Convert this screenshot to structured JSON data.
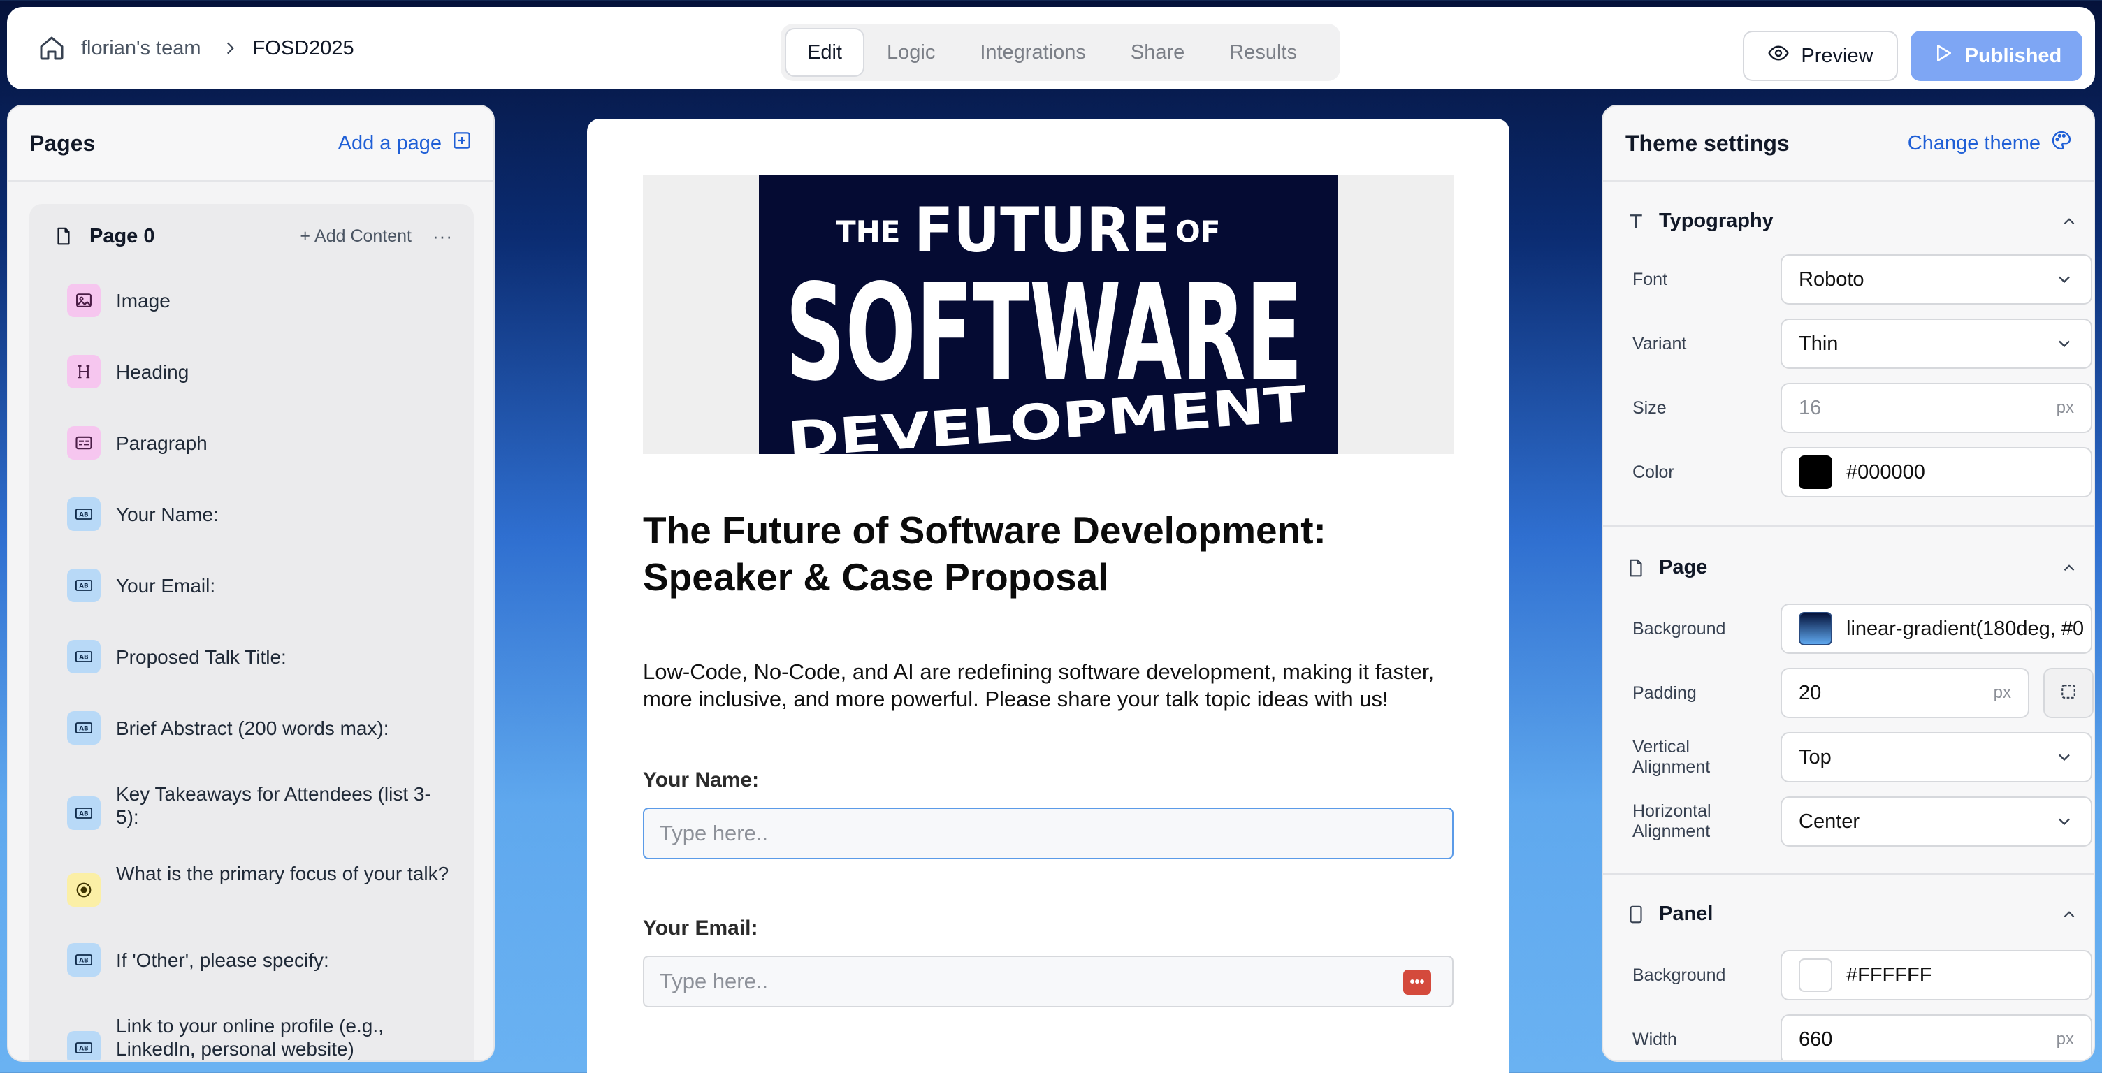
{
  "header": {
    "team": "florian's team",
    "project": "FOSD2025",
    "tabs": [
      {
        "label": "Edit",
        "active": true
      },
      {
        "label": "Logic",
        "active": false
      },
      {
        "label": "Integrations",
        "active": false
      },
      {
        "label": "Share",
        "active": false
      },
      {
        "label": "Results",
        "active": false
      }
    ],
    "preview_label": "Preview",
    "published_label": "Published"
  },
  "pages_panel": {
    "title": "Pages",
    "add_page_label": "Add a page",
    "page": {
      "name": "Page 0",
      "add_content_label": "Add Content",
      "more_label": "···",
      "items": [
        {
          "label": "Image",
          "type": "image",
          "icon": "image-icon"
        },
        {
          "label": "Heading",
          "type": "heading",
          "icon": "heading-icon"
        },
        {
          "label": "Paragraph",
          "type": "paragraph",
          "icon": "paragraph-icon"
        },
        {
          "label": "Your Name:",
          "type": "text",
          "icon": "text-field-icon"
        },
        {
          "label": "Your Email:",
          "type": "text",
          "icon": "text-field-icon"
        },
        {
          "label": "Proposed Talk Title:",
          "type": "text",
          "icon": "text-field-icon"
        },
        {
          "label": "Brief Abstract (200 words max):",
          "type": "text",
          "icon": "text-field-icon"
        },
        {
          "label": "Key Takeaways for Attendees (list 3-5):",
          "type": "text",
          "icon": "text-field-icon"
        },
        {
          "label": "What is the primary focus of your talk?",
          "type": "choice",
          "icon": "radio-icon"
        },
        {
          "label": "If 'Other', please specify:",
          "type": "text",
          "icon": "text-field-icon"
        },
        {
          "label": "Link to your online profile (e.g., LinkedIn, personal website)",
          "type": "text",
          "icon": "text-field-icon"
        }
      ]
    }
  },
  "form": {
    "banner": {
      "line1a": "THE",
      "line1b": "FUTURE",
      "line1c": "OF",
      "line2": "SOFTWARE",
      "line3": "DEVELOPMENT"
    },
    "title": "The Future of Software Development: Speaker & Case Proposal",
    "description": "Low-Code, No-Code, and AI are redefining software development, making it faster, more inclusive, and more powerful. Please share your talk topic ideas with us!",
    "fields": [
      {
        "label": "Your Name:",
        "placeholder": "Type here..",
        "focused": true
      },
      {
        "label": "Your Email:",
        "placeholder": "Type here..",
        "focused": false
      }
    ]
  },
  "theme_panel": {
    "title": "Theme settings",
    "change_theme_label": "Change theme",
    "typography": {
      "title": "Typography",
      "font_label": "Font",
      "font_value": "Roboto",
      "variant_label": "Variant",
      "variant_value": "Thin",
      "size_label": "Size",
      "size_value": "16",
      "size_unit": "px",
      "color_label": "Color",
      "color_value": "#000000"
    },
    "page": {
      "title": "Page",
      "background_label": "Background",
      "background_value": "linear-gradient(180deg, #0",
      "padding_label": "Padding",
      "padding_value": "20",
      "padding_unit": "px",
      "valign_label": "Vertical Alignment",
      "valign_value": "Top",
      "halign_label": "Horizontal Alignment",
      "halign_value": "Center"
    },
    "panel": {
      "title": "Panel",
      "background_label": "Background",
      "background_value": "#FFFFFF",
      "width_label": "Width",
      "width_value": "660",
      "width_unit": "px"
    }
  },
  "colors": {
    "accent": "#1f5fd6",
    "published_button": "#7ea6f4",
    "banner_bg": "#050b33"
  }
}
